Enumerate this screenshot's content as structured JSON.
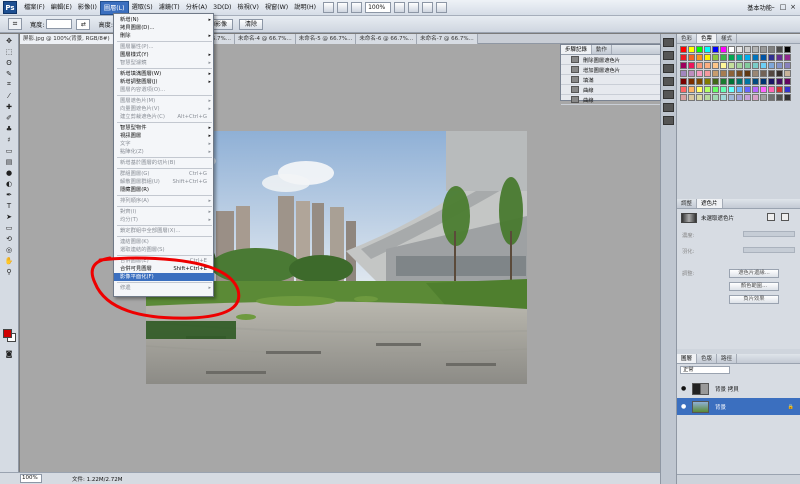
{
  "menubar": {
    "items": [
      "檔案(F)",
      "編輯(E)",
      "影像(I)",
      "圖層(L)",
      "選取(S)",
      "濾鏡(T)",
      "分析(A)",
      "3D(D)",
      "檢視(V)",
      "視窗(W)",
      "說明(H)"
    ],
    "active_index": 3,
    "zoom": "100%",
    "workspace": "基本功能"
  },
  "options": {
    "width_label": "寬度:",
    "height_label": "高度:",
    "front_image_button": "前面的影像",
    "clear_button": "清除"
  },
  "document": {
    "tabs": [
      "屏影.jpg @ 100%(背景, RGB/8#)",
      "未命名-2 @ 66.7%...",
      "未命名-3 @ 66.7%...",
      "未命名-4 @ 66.7%...",
      "未命名-5 @ 66.7%...",
      "未命名-6 @ 66.7%...",
      "未命名-7 @ 66.7%..."
    ]
  },
  "layer_menu": {
    "items": [
      {
        "label": "新增(N)",
        "sub": true,
        "disabled": false
      },
      {
        "label": "拷貝圖層(D)...",
        "disabled": false
      },
      {
        "label": "刪除",
        "sub": true,
        "disabled": false
      },
      {
        "sep": true
      },
      {
        "label": "圖層屬性(P)...",
        "disabled": true
      },
      {
        "label": "圖層樣式(Y)",
        "sub": true,
        "disabled": false
      },
      {
        "label": "智慧型濾鏡",
        "sub": true,
        "disabled": true
      },
      {
        "sep": true
      },
      {
        "label": "新增填滿圖層(W)",
        "sub": true,
        "disabled": false
      },
      {
        "label": "新增調整圖層(J)",
        "sub": true,
        "disabled": false
      },
      {
        "label": "圖層內容選項(O)...",
        "disabled": true
      },
      {
        "sep": true
      },
      {
        "label": "圖層遮色片(M)",
        "sub": true,
        "disabled": true
      },
      {
        "label": "向量圖遮色片(V)",
        "sub": true,
        "disabled": true
      },
      {
        "label": "建立剪裁遮色片(C)",
        "shortcut": "Alt+Ctrl+G",
        "disabled": true
      },
      {
        "sep": true
      },
      {
        "label": "智慧型物件",
        "sub": true,
        "disabled": false
      },
      {
        "label": "視訊圖層",
        "sub": true,
        "disabled": false
      },
      {
        "label": "文字",
        "sub": true,
        "disabled": true
      },
      {
        "label": "點陣化(Z)",
        "sub": true,
        "disabled": true
      },
      {
        "sep": true
      },
      {
        "label": "新增基於圖層的切片(B)",
        "disabled": true
      },
      {
        "sep": true
      },
      {
        "label": "群組圖層(G)",
        "shortcut": "Ctrl+G",
        "disabled": true
      },
      {
        "label": "解散圖層群組(U)",
        "shortcut": "Shift+Ctrl+G",
        "disabled": true
      },
      {
        "label": "隱藏圖層(R)",
        "disabled": false
      },
      {
        "sep": true
      },
      {
        "label": "排列順序(A)",
        "sub": true,
        "disabled": true
      },
      {
        "sep": true
      },
      {
        "label": "對齊(I)",
        "sub": true,
        "disabled": true
      },
      {
        "label": "均分(T)",
        "sub": true,
        "disabled": true
      },
      {
        "sep": true
      },
      {
        "label": "鎖定群組中全部圖層(X)...",
        "disabled": true
      },
      {
        "sep": true
      },
      {
        "label": "連結圖層(K)",
        "disabled": true
      },
      {
        "label": "選取連結的圖層(S)",
        "disabled": true
      },
      {
        "sep": true
      },
      {
        "label": "合併圖層(E)",
        "shortcut": "Ctrl+E",
        "disabled": true
      },
      {
        "label": "合併可見圖層",
        "shortcut": "Shift+Ctrl+E",
        "disabled": false
      },
      {
        "label": "影像平面化(F)",
        "disabled": false,
        "selected": true
      },
      {
        "sep": true
      },
      {
        "label": "修邊",
        "sub": true,
        "disabled": true
      }
    ]
  },
  "history": {
    "tabs": [
      "步驟記錄",
      "動作"
    ],
    "items": [
      "刪除圖層遮色片",
      "增加圖層遮色片",
      "填滿",
      "曲線",
      "曲線"
    ]
  },
  "swatches": {
    "tabs": [
      "色彩",
      "色票",
      "樣式"
    ]
  },
  "adjustments": {
    "tabs": [
      "調整",
      "遮色片"
    ],
    "title": "未選取遮色片",
    "density_label": "濃度:",
    "feather_label": "羽化:",
    "refine_label": "調整:",
    "mask_edge_button": "遮色片邊緣...",
    "color_range_button": "顏色範圍...",
    "invert_button": "負片效果"
  },
  "layers": {
    "tabs": [
      "圖層",
      "色版",
      "路徑"
    ],
    "mode": "正常",
    "items": [
      {
        "name": "背景 拷貝",
        "selected": false
      },
      {
        "name": "背景",
        "selected": true
      }
    ]
  },
  "status": {
    "zoom": "100%",
    "doc_info": "文件: 1.22M/2.72M"
  },
  "colors": {
    "menu_highlight": "#3b6fbf",
    "foreground": "#d00000",
    "annotation": "#ee0000"
  }
}
